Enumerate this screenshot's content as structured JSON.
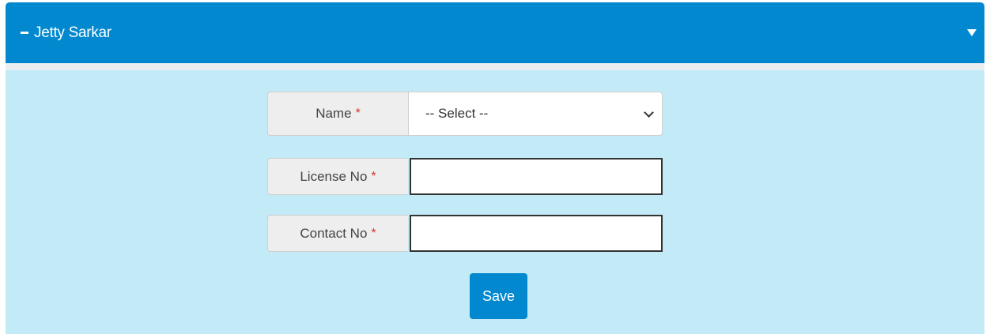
{
  "panel": {
    "title": "Jetty Sarkar",
    "collapse_icon": "minus-icon",
    "toggle_icon": "caret-down-icon"
  },
  "form": {
    "name_label": "Name",
    "name_select_value": "-- Select --",
    "license_label": "License No",
    "license_value": "",
    "contact_label": "Contact No",
    "contact_value": "",
    "required_marker": "*",
    "save_label": "Save"
  },
  "colors": {
    "header": "#0288cf",
    "body": "#c2eaf7",
    "required": "#d9302c",
    "button": "#0288cf"
  }
}
